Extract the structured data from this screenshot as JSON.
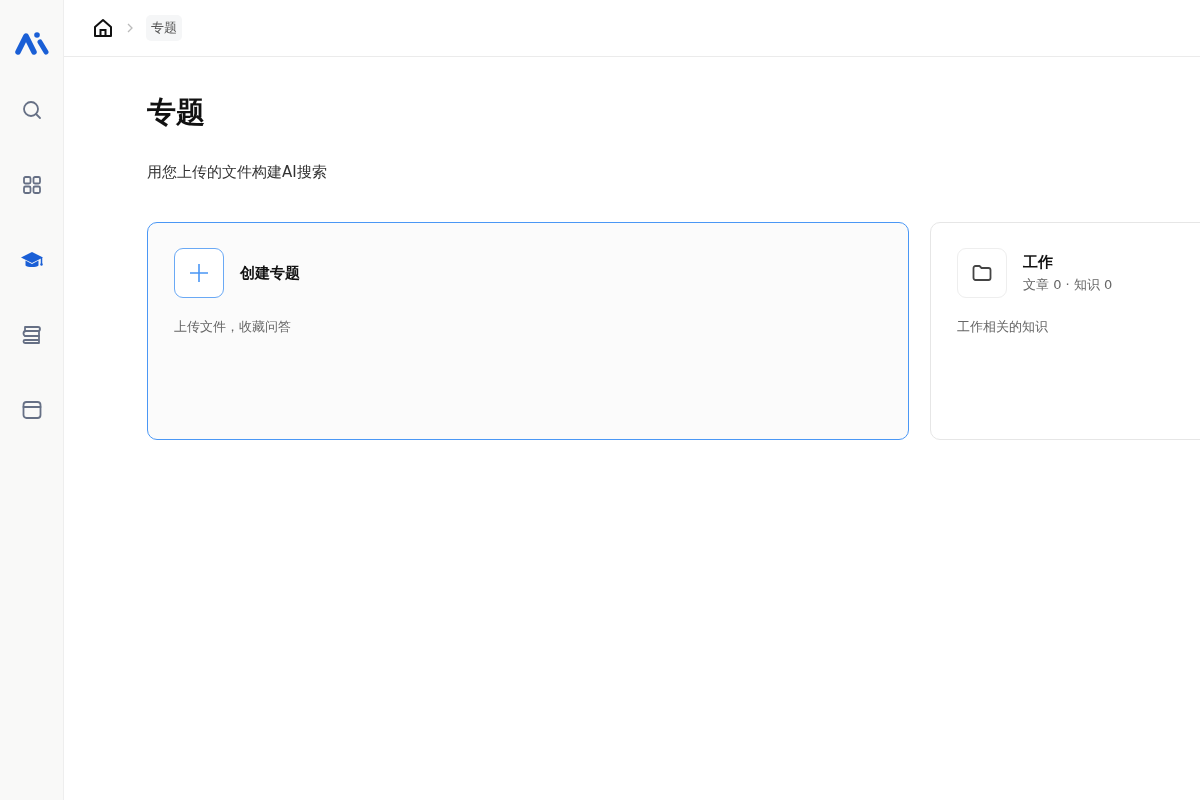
{
  "sidebar": {
    "items": [
      {
        "kind": "search",
        "selected": false
      },
      {
        "kind": "grid",
        "selected": false
      },
      {
        "kind": "cap",
        "selected": true
      },
      {
        "kind": "stack",
        "selected": false
      },
      {
        "kind": "window",
        "selected": false
      }
    ]
  },
  "breadcrumb": {
    "current": "专题"
  },
  "page": {
    "title": "专题",
    "subtitle": "用您上传的文件构建AI搜索"
  },
  "cards": [
    {
      "kind": "create",
      "title": "创建专题",
      "description": "上传文件，收藏问答"
    },
    {
      "kind": "topic",
      "title": "工作",
      "meta": "文章 0 · 知识 0",
      "description": "工作相关的知识"
    }
  ]
}
